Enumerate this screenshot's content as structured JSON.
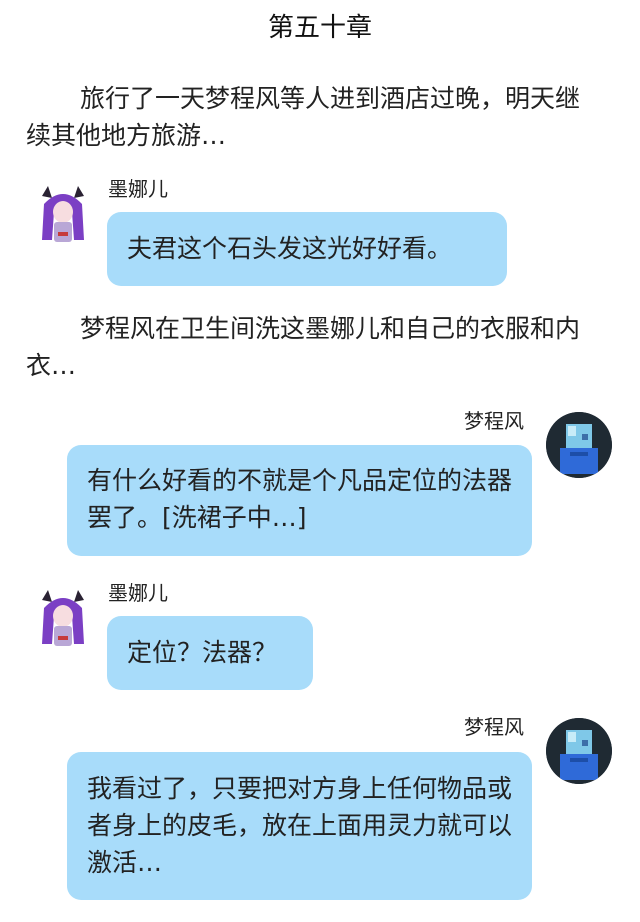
{
  "chapter_title": "第五十章",
  "narration": [
    "旅行了一天梦程风等人进到酒店过晚，明天继续其他地方旅游…",
    "梦程风在卫生间洗这墨娜儿和自己的衣服和内衣…"
  ],
  "messages": [
    {
      "speaker": "墨娜儿",
      "side": "left",
      "text": "夫君这个石头发这光好好看。",
      "avatar": "purple-haired-girl-avatar"
    },
    {
      "speaker": "梦程风",
      "side": "right",
      "text": "有什么好看的不就是个凡品定位的法器罢了。[洗裙子中…]",
      "avatar": "blocky-blue-character-avatar"
    },
    {
      "speaker": "墨娜儿",
      "side": "left",
      "text": "定位？法器？",
      "avatar": "purple-haired-girl-avatar"
    },
    {
      "speaker": "梦程风",
      "side": "right",
      "text": "我看过了，只要把对方身上任何物品或者身上的皮毛，放在上面用灵力就可以激活…",
      "avatar": "blocky-blue-character-avatar"
    }
  ],
  "colors": {
    "bubble": "#a8dcfa",
    "background": "#ffffff",
    "avatar_dark": "#1f2a33",
    "hair": "#7b3fc4"
  }
}
